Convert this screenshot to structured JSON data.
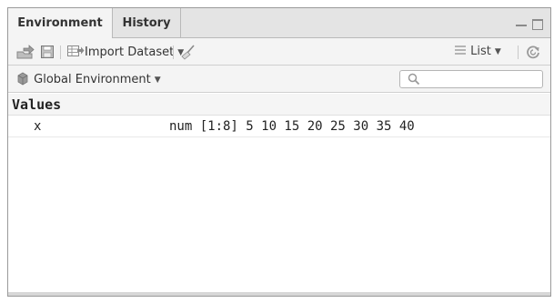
{
  "tabs": [
    {
      "label": "Environment",
      "active": true
    },
    {
      "label": "History",
      "active": false
    }
  ],
  "toolbar": {
    "import_label": "Import Dataset",
    "list_label": "List"
  },
  "env_selector": {
    "label": "Global Environment"
  },
  "search": {
    "placeholder": ""
  },
  "sections": [
    {
      "title": "Values",
      "items": [
        {
          "name": "x",
          "value": "num [1:8] 5 10 15 20 25 30 35 40"
        }
      ]
    }
  ],
  "colors": {
    "tabbar": "#e4e4e4",
    "toolbar": "#f4f4f4",
    "border": "#9a9a9a"
  },
  "icons": [
    "load-workspace-icon",
    "save-icon",
    "import-dataset-icon",
    "broom-icon",
    "list-view-icon",
    "refresh-icon",
    "environment-icon",
    "search-icon"
  ]
}
